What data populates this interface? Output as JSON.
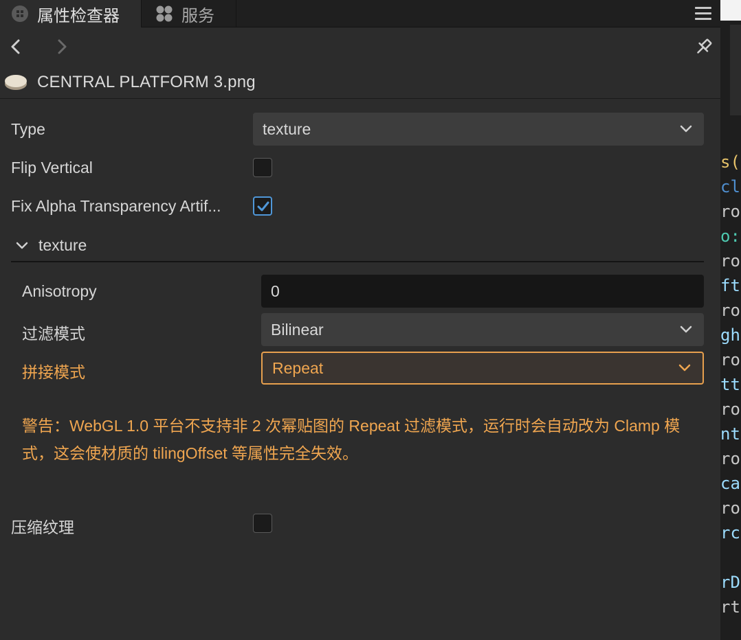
{
  "tabs": {
    "active": "属性检查器",
    "inactive": "服务"
  },
  "asset": {
    "name": "CENTRAL PLATFORM 3.png"
  },
  "props": {
    "type_label": "Type",
    "type_value": "texture",
    "flip_label": "Flip Vertical",
    "flip_checked": false,
    "fix_alpha_label": "Fix Alpha Transparency Artif...",
    "fix_alpha_checked": true,
    "section_title": "texture",
    "anisotropy_label": "Anisotropy",
    "anisotropy_value": "0",
    "filter_label": "过滤模式",
    "filter_value": "Bilinear",
    "wrap_label": "拼接模式",
    "wrap_value": "Repeat",
    "warning": "警告：WebGL 1.0 平台不支持非 2 次幂贴图的 Repeat 过滤模式，运行时会自动改为 Clamp 模式，这会使材质的 tilingOffset 等属性完全失效。",
    "compress_label": "压缩纹理",
    "compress_checked": false
  },
  "code_strip": {
    "lines": [
      {
        "text": "s(",
        "color": "#e8c46a"
      },
      {
        "text": "cl",
        "color": "#4f8fd0"
      },
      {
        "text": "rop",
        "color": "#c8c8c8"
      },
      {
        "text": "o:N",
        "color": "#4ec9b0"
      },
      {
        "text": "rop",
        "color": "#c8c8c8"
      },
      {
        "text": "ft:",
        "color": "#9cdcfe"
      },
      {
        "text": "rop",
        "color": "#c8c8c8"
      },
      {
        "text": "ght",
        "color": "#9cdcfe"
      },
      {
        "text": "rop",
        "color": "#c8c8c8"
      },
      {
        "text": "tto",
        "color": "#9cdcfe"
      },
      {
        "text": "rop",
        "color": "#c8c8c8"
      },
      {
        "text": "nte",
        "color": "#9cdcfe"
      },
      {
        "text": "rop",
        "color": "#c8c8c8"
      },
      {
        "text": "car",
        "color": "#9cdcfe"
      },
      {
        "text": "rop",
        "color": "#c8c8c8"
      },
      {
        "text": "rca",
        "color": "#9cdcfe"
      },
      {
        "text": "rDe",
        "color": "#9cdcfe"
      },
      {
        "text": "rt",
        "color": "#c8c8c8"
      }
    ]
  },
  "colors": {
    "accent_warning": "#f0a650",
    "checkbox_accent": "#4f97d8"
  }
}
